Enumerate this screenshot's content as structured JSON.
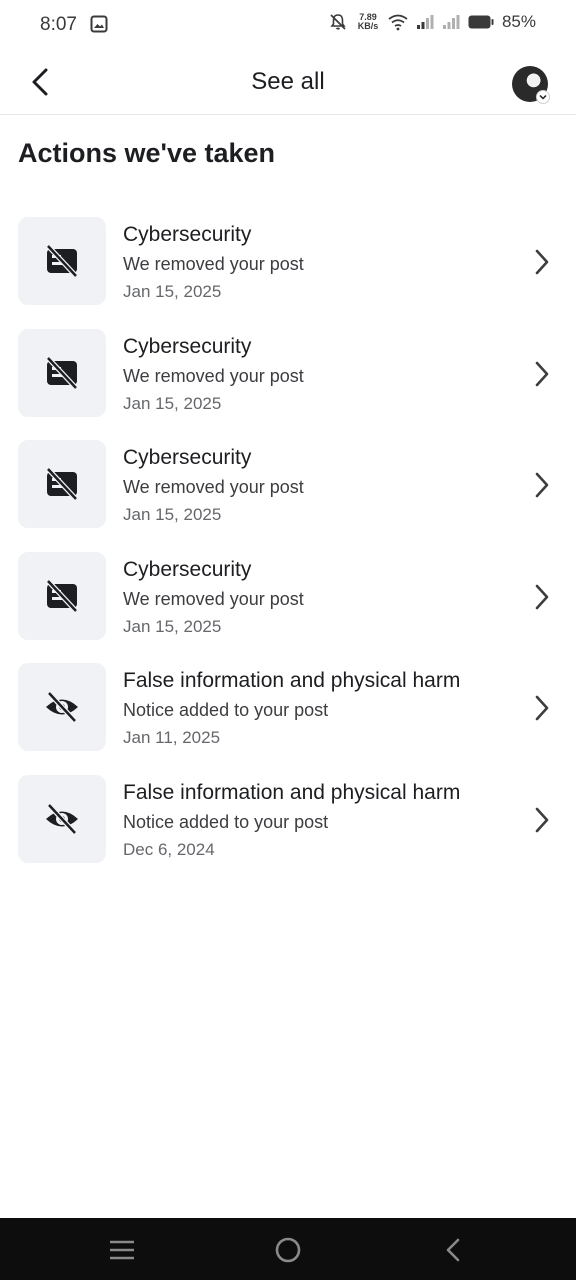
{
  "status_bar": {
    "time": "8:07",
    "net_speed_value": "7.89",
    "net_speed_unit": "KB/s",
    "battery": "85%",
    "icons": [
      "gallery-icon",
      "mute-icon",
      "wifi-icon",
      "signal-icon",
      "signal-icon-2",
      "battery-icon"
    ]
  },
  "header": {
    "title": "See all",
    "back_icon": "back-arrow-icon",
    "avatar": "profile-avatar"
  },
  "section": {
    "title": "Actions we've taken"
  },
  "items": [
    {
      "icon": "removed-post-icon",
      "title": "Cybersecurity",
      "subtitle": "We removed your post",
      "date": "Jan 15, 2025"
    },
    {
      "icon": "removed-post-icon",
      "title": "Cybersecurity",
      "subtitle": "We removed your post",
      "date": "Jan 15, 2025"
    },
    {
      "icon": "removed-post-icon",
      "title": "Cybersecurity",
      "subtitle": "We removed your post",
      "date": "Jan 15, 2025"
    },
    {
      "icon": "removed-post-icon",
      "title": "Cybersecurity",
      "subtitle": "We removed your post",
      "date": "Jan 15, 2025"
    },
    {
      "icon": "eye-off-icon",
      "title": "False information and physical harm",
      "subtitle": "Notice added to your post",
      "date": "Jan 11, 2025"
    },
    {
      "icon": "eye-off-icon",
      "title": "False information and physical harm",
      "subtitle": "Notice added to your post",
      "date": "Dec 6, 2024"
    }
  ],
  "nav": {
    "icons": [
      "menu-icon",
      "home-circle-icon",
      "back-triangle-icon"
    ]
  },
  "colors": {
    "icon_box": "#f0f2f5",
    "text_primary": "#1c1e21",
    "text_secondary": "#65676b",
    "nav_bar": "#0d0d0d"
  }
}
